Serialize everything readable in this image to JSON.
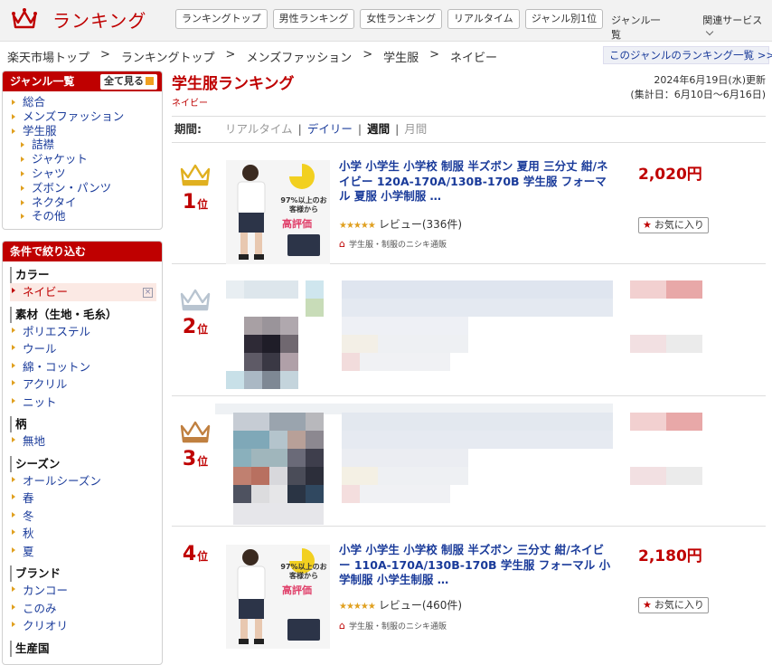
{
  "header": {
    "logo_text": "ランキング",
    "nav": [
      "ランキングトップ",
      "男性ランキング",
      "女性ランキング",
      "リアルタイム",
      "ジャンル別1位"
    ],
    "right_links": [
      "ジャンル一覧",
      "関連サービス"
    ]
  },
  "breadcrumb": [
    "楽天市場トップ",
    "ランキングトップ",
    "メンズファッション",
    "学生服",
    "ネイビー"
  ],
  "genre_list_link": "このジャンルのランキング一覧 >>",
  "sidebar": {
    "genre_title": "ジャンル一覧",
    "see_all": "全て見る",
    "genres": [
      {
        "label": "総合",
        "sub": false
      },
      {
        "label": "メンズファッション",
        "sub": false
      },
      {
        "label": "学生服",
        "sub": false
      },
      {
        "label": "詰襟",
        "sub": true
      },
      {
        "label": "ジャケット",
        "sub": true
      },
      {
        "label": "シャツ",
        "sub": true
      },
      {
        "label": "ズボン・パンツ",
        "sub": true
      },
      {
        "label": "ネクタイ",
        "sub": true
      },
      {
        "label": "その他",
        "sub": true
      }
    ],
    "filter_title": "条件で絞り込む",
    "filters": [
      {
        "heading": "カラー",
        "items": [
          {
            "label": "ネイビー",
            "active": true
          }
        ]
      },
      {
        "heading": "素材（生地・毛糸）",
        "items": [
          {
            "label": "ポリエステル"
          },
          {
            "label": "ウール"
          },
          {
            "label": "綿・コットン"
          },
          {
            "label": "アクリル"
          },
          {
            "label": "ニット"
          }
        ]
      },
      {
        "heading": "柄",
        "items": [
          {
            "label": "無地"
          }
        ]
      },
      {
        "heading": "シーズン",
        "items": [
          {
            "label": "オールシーズン"
          },
          {
            "label": "春"
          },
          {
            "label": "冬"
          },
          {
            "label": "秋"
          },
          {
            "label": "夏"
          }
        ]
      },
      {
        "heading": "ブランド",
        "items": [
          {
            "label": "カンコー"
          },
          {
            "label": "このみ"
          },
          {
            "label": "クリオリ"
          }
        ]
      },
      {
        "heading": "生産国",
        "items": []
      }
    ]
  },
  "main": {
    "title": "学生服ランキング",
    "subtitle": "ネイビー",
    "updated": "2024年6月19日(水)更新",
    "period_range": "(集計日：6月10日～6月16日)",
    "period_label": "期間:",
    "periods": [
      {
        "label": "リアルタイム",
        "state": "disabled"
      },
      {
        "label": "デイリー",
        "state": "link"
      },
      {
        "label": "週間",
        "state": "current"
      },
      {
        "label": "月間",
        "state": "disabled"
      }
    ]
  },
  "items": [
    {
      "rank": "1",
      "rank_suffix": "位",
      "crown_color": "#e0b020",
      "title": "小学 小学生 小学校 制服 半ズボン 夏用 三分丈 紺/ネイビー 120A-170A/130B-170B 学生服 フォーマル 夏服 小学制服 …",
      "rating_stars": "★★★★★",
      "reviews": "レビュー(336件)",
      "shop": "学生服・制服のニシキ通販",
      "price": "2,020円",
      "fav_label": "お気に入り",
      "thumb_badge": "97%以上のお客様から",
      "thumb_badge2": "高評価"
    },
    {
      "rank": "2",
      "rank_suffix": "位",
      "crown_color": "#b8c4d0"
    },
    {
      "rank": "3",
      "rank_suffix": "位",
      "crown_color": "#c08040"
    },
    {
      "rank": "4",
      "rank_suffix": "位",
      "title": "小学 小学生 小学校 制服 半ズボン 三分丈 紺/ネイビー 110A-170A/130B-170B 学生服 フォーマル 小学制服 小学生制服 …",
      "rating_stars": "★★★★★",
      "reviews": "レビュー(460件)",
      "shop": "学生服・制服のニシキ通販",
      "price": "2,180円",
      "fav_label": "お気に入り",
      "thumb_badge": "97%以上のお客様から",
      "thumb_badge2": "高評価"
    }
  ]
}
